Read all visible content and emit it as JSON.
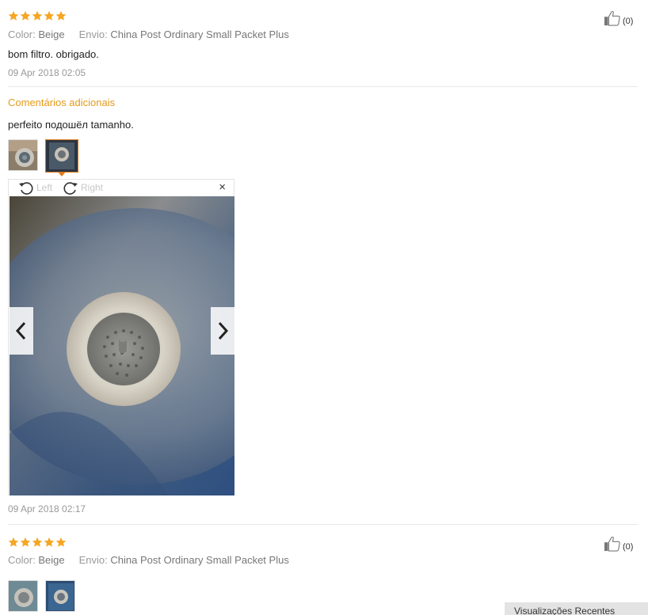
{
  "review1": {
    "stars": 5,
    "color_key": "Color:",
    "color_value": "Beige",
    "shipping_key": "Envio:",
    "shipping_value": "China Post Ordinary Small Packet Plus",
    "text": "bom filtro. obrigado.",
    "date": "09 Apr 2018 02:05",
    "likes": "(0)",
    "additional_heading": "Comentários adicionais",
    "additional_text": "perfeito подошёл tamanho.",
    "additional_date": "09 Apr 2018 02:17",
    "thumbnails": 2,
    "viewer": {
      "left_label": "Left",
      "right_label": "Right",
      "close": "×"
    }
  },
  "review2": {
    "stars": 5,
    "color_key": "Color:",
    "color_value": "Beige",
    "shipping_key": "Envio:",
    "shipping_value": "China Post Ordinary Small Packet Plus",
    "likes": "(0)",
    "thumbnails": 2
  },
  "corner_button": "Visualizações Recentes",
  "colors": {
    "star": "#f5a623",
    "accent": "#e59a1c",
    "active_border": "#e07a1a"
  },
  "icons": [
    "star-icon",
    "thumbs-up-icon",
    "rotate-left-icon",
    "rotate-right-icon",
    "close-icon",
    "chevron-left-icon",
    "chevron-right-icon"
  ]
}
